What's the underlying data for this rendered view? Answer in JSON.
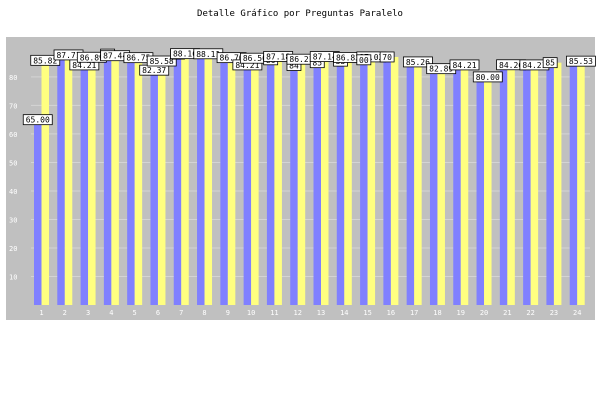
{
  "chart_data": {
    "type": "bar",
    "title": "Detalle Gráfico por Preguntas Paralelo",
    "xlabel": "",
    "ylabel": "",
    "categories": [
      "1",
      "2",
      "3",
      "4",
      "5",
      "6",
      "7",
      "8",
      "9",
      "10",
      "11",
      "12",
      "13",
      "14",
      "15",
      "16",
      "17",
      "18",
      "19",
      "20",
      "21",
      "22",
      "23",
      "24"
    ],
    "yticks": [
      "10",
      "20",
      "30",
      "40",
      "50",
      "60",
      "70",
      "80"
    ],
    "ylim": [
      0,
      94
    ],
    "grid": true,
    "legend": "none",
    "series": [
      {
        "color": "#8080ff",
        "values": [
          65.0,
          87.71,
          84.21,
          88.0,
          86.75,
          82.37,
          88.0,
          88.11,
          86.76,
          84.21,
          86.0,
          84.0,
          85.0,
          85.53,
          86.0,
          87.0,
          85.26,
          82.89,
          84.21,
          80.0,
          84.21,
          84.0,
          85.0,
          85.53
        ]
      },
      {
        "color": "#ffff80",
        "values": [
          85.82,
          87.71,
          86.89,
          87.44,
          86.75,
          85.58,
          88.16,
          88.11,
          86.76,
          86.56,
          87.18,
          86.21,
          87.14,
          86.83,
          87.02,
          87.0,
          85.26,
          82.89,
          84.21,
          80.0,
          84.26,
          84.21,
          85.0,
          85.53
        ]
      }
    ],
    "labels": [
      {
        "text": "65.00",
        "series": 0,
        "index": 0
      },
      {
        "text": "85.82",
        "series": 1,
        "index": 0
      },
      {
        "text": "87.71",
        "series": 1,
        "index": 1
      },
      {
        "text": "84.21",
        "series": 0,
        "index": 2
      },
      {
        "text": "86.89",
        "series": 1,
        "index": 2
      },
      {
        "text": "88",
        "series": 0,
        "index": 3
      },
      {
        "text": "87.44",
        "series": 1,
        "index": 3
      },
      {
        "text": "86.75",
        "series": 1,
        "index": 4
      },
      {
        "text": "82.37",
        "series": 0,
        "index": 5
      },
      {
        "text": "85.58",
        "series": 1,
        "index": 5
      },
      {
        "text": "88",
        "series": 0,
        "index": 6
      },
      {
        "text": "88.16",
        "series": 1,
        "index": 6
      },
      {
        "text": "88.11",
        "series": 1,
        "index": 7
      },
      {
        "text": "86.76",
        "series": 1,
        "index": 8
      },
      {
        "text": "84.21",
        "series": 0,
        "index": 9
      },
      {
        "text": "86.56",
        "series": 1,
        "index": 9
      },
      {
        "text": "86",
        "series": 0,
        "index": 10
      },
      {
        "text": "87.18",
        "series": 1,
        "index": 10
      },
      {
        "text": "84",
        "series": 0,
        "index": 11
      },
      {
        "text": "86.21",
        "series": 1,
        "index": 11
      },
      {
        "text": "85",
        "series": 0,
        "index": 12
      },
      {
        "text": "87.14",
        "series": 1,
        "index": 12
      },
      {
        "text": "53",
        "series": 0,
        "index": 13
      },
      {
        "text": "86.83",
        "series": 1,
        "index": 13
      },
      {
        "text": "87.02",
        "series": 1,
        "index": 14
      },
      {
        "text": "00",
        "series": 0,
        "index": 14
      },
      {
        "text": "70",
        "series": 0,
        "index": 15
      },
      {
        "text": "85.26",
        "series": 1,
        "index": 16
      },
      {
        "text": "82.89",
        "series": 1,
        "index": 17
      },
      {
        "text": "84.21",
        "series": 1,
        "index": 18
      },
      {
        "text": "80.00",
        "series": 1,
        "index": 19
      },
      {
        "text": "84.26",
        "series": 1,
        "index": 20
      },
      {
        "text": "84.21",
        "series": 1,
        "index": 21
      },
      {
        "text": "85",
        "series": 0,
        "index": 22
      },
      {
        "text": "85.53",
        "series": 1,
        "index": 23
      }
    ]
  }
}
